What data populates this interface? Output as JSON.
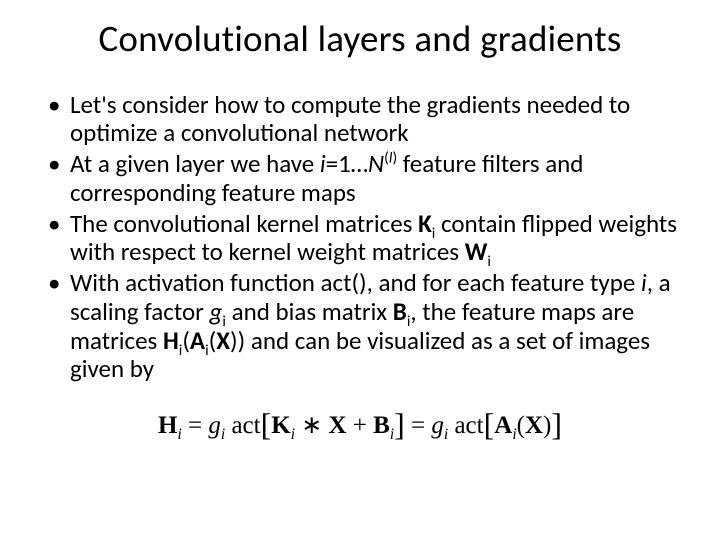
{
  "title": "Convolutional layers and gradients",
  "bullets": {
    "b1": "Let's consider how to compute the gradients needed to optimize a convolutional network",
    "b2a": "At a given layer we have ",
    "b2_i": "i",
    "b2_eq": "=1…",
    "b2_N": "N",
    "b2_sup_open": "(",
    "b2_sup_l": "l",
    "b2_sup_close": ")",
    "b2b": " feature filters and corresponding feature maps",
    "b3a": "The convolutional kernel matrices ",
    "b3_K": "K",
    "b3_i1": "i",
    "b3b": " contain flipped weights with respect to kernel weight matrices ",
    "b3_W": "W",
    "b3_i2": "i",
    "b4a": "With activation function act(), and for each feature type ",
    "b4_iA": "i",
    "b4b": ", a scaling factor ",
    "b4_g": "g",
    "b4_iB": "i",
    "b4c": " and bias matrix ",
    "b4_B": "B",
    "b4_iC": "i",
    "b4d": ", the feature maps are matrices ",
    "b4_H": "H",
    "b4_iD": "i",
    "b4_open": "(",
    "b4_A": "A",
    "b4_iE": "i",
    "b4_open2": "(",
    "b4_X": "X",
    "b4_close": "))",
    "b4e": " and can be visualized as a set of images given by"
  },
  "formula": {
    "H": "H",
    "i1": "i",
    "eq1": " = ",
    "g": "g",
    "i2": "i",
    "sp1": " ",
    "act1": "act",
    "lb1": "[",
    "K": "K",
    "i3": "i",
    "conv": " ∗ ",
    "X1": "X",
    "plus": " + ",
    "B": "B",
    "i4": "i",
    "rb1": "]",
    "eq2": " = ",
    "g2": "g",
    "i5": "i",
    "sp2": " ",
    "act2": "act",
    "lb2": "[",
    "A": "A",
    "i6": "i",
    "open": "(",
    "X2": "X",
    "close": ")",
    "rb2": "]"
  }
}
